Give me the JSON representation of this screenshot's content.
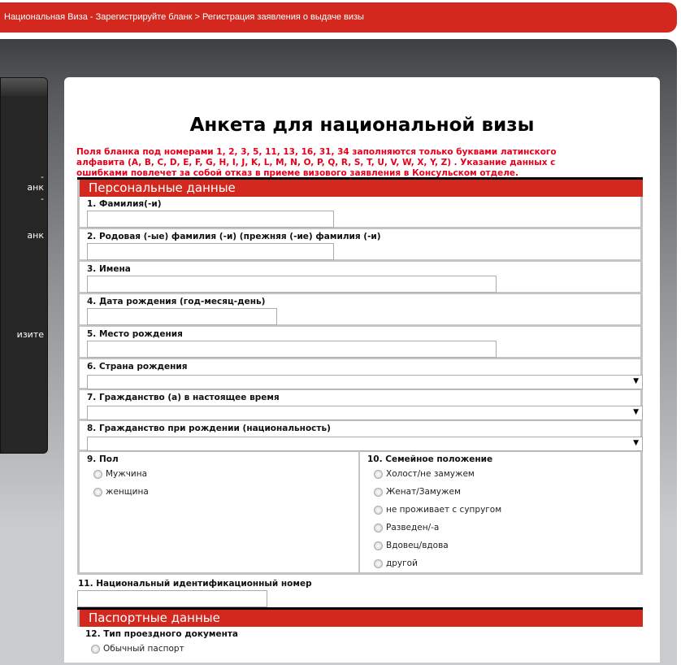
{
  "breadcrumb": "Национальная Виза - Зарегистрируйте бланк > Регистрация заявления о выдаче визы",
  "sidebar": {
    "fragments": [
      "-",
      "анк",
      "-",
      "анк",
      "изите"
    ]
  },
  "title": "Анкета для национальной визы",
  "warning": "Поля бланка под номерами 1, 2, 3, 5, 11, 13, 16, 31, 34 заполняются только буквами латинского алфавита (A, B, C, D, E, F, G, H, I, J, K, L, M, N, O, P, Q, R, S, T, U, V, W, X, Y, Z) . Указание данных с ошибками повлечет за собой отказ в приеме визового заявления в Консульском отделе.",
  "personal": {
    "header": "Персональные данные",
    "f1": "1. Фамилия(-и)",
    "f2": "2. Родовая (-ые) фамилия (-и) (прежняя (-ие) фамилия (-и)",
    "f3": "3. Имена",
    "f4": "4. Дата рождения (год-месяц-день)",
    "f5": "5. Место рождения",
    "f6": "6. Страна рождения",
    "f7": "7. Гражданство (а) в настоящее время",
    "f8": "8. Гражданство при рождении (национальность)",
    "f9": "9. Пол",
    "sex": [
      "Мужчина",
      "женщина"
    ],
    "f10": "10. Семейное положение",
    "marital": [
      "Холост/не замужем",
      "Женат/Замужем",
      "не проживает с супругом",
      "Разведен/-а",
      "Вдовец/вдова",
      "другой"
    ],
    "f11": "11. Национальный идентификационный номер"
  },
  "passport": {
    "header": "Паспортные данные",
    "f12": "12. Тип проездного документа",
    "types": [
      "Обычный паспорт"
    ]
  }
}
